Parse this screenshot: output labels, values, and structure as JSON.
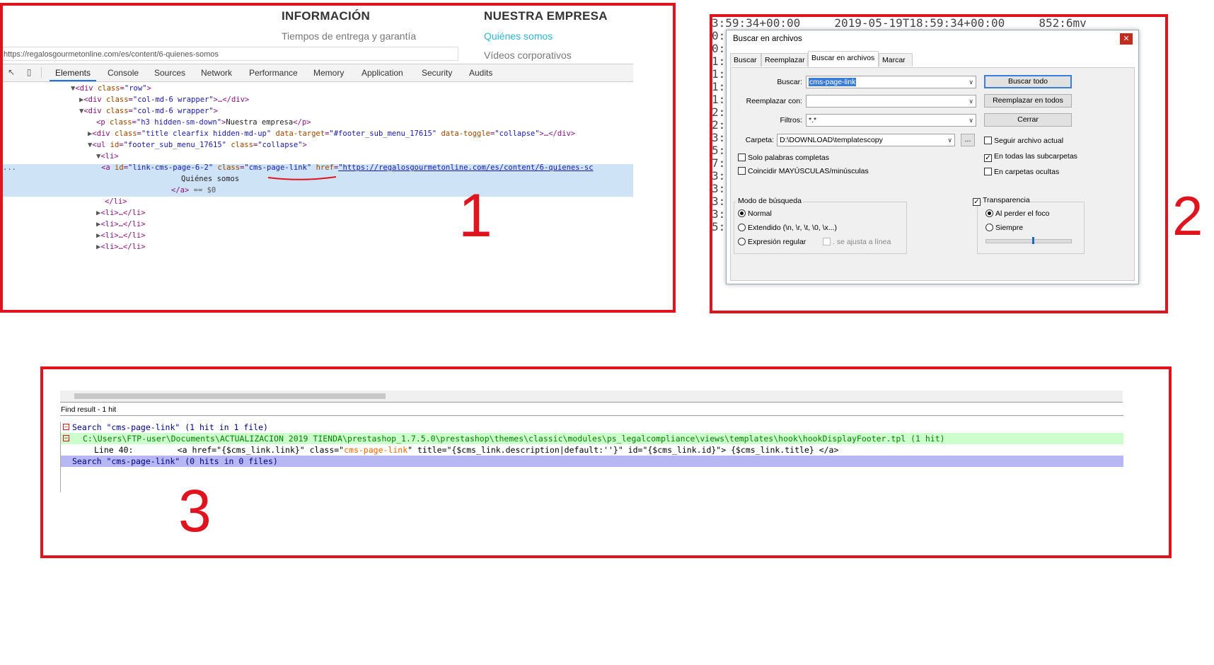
{
  "labels": [
    "1",
    "2",
    "3"
  ],
  "panel1": {
    "site": {
      "heading1": "INFORMACIÓN",
      "link1": "Tiempos de entrega y garantía",
      "heading2": "NUESTRA EMPRESA",
      "link2": "Quiénes somos",
      "link3": "Vídeos corporativos",
      "url": "https://regalosgourmetonline.com/es/content/6-quienes-somos"
    },
    "tabs": [
      "Elements",
      "Console",
      "Sources",
      "Network",
      "Performance",
      "Memory",
      "Application",
      "Security",
      "Audits"
    ],
    "active_tab": "Elements",
    "dom": {
      "l1_tag": "<div ",
      "l1_an": "class",
      "l1_av": "\"row\"",
      "l1_end": ">",
      "l2_pre": "▶",
      "l2_tag": "<div ",
      "l2_an": "class",
      "l2_av": "\"col-md-6 wrapper\"",
      "l2_end": ">…</div>",
      "l3_pre": "▼",
      "l3_tag": "<div ",
      "l3_an": "class",
      "l3_av": "\"col-md-6 wrapper\"",
      "l3_end": ">",
      "l4_tag": "<p ",
      "l4_an": "class",
      "l4_av": "\"h3 hidden-sm-down\"",
      "l4_tx": "Nuestra empresa",
      "l4_end": "</p>",
      "l5_pre": "▶",
      "l5_tag": "<div ",
      "l5_an": "class",
      "l5_av": "\"title clearfix hidden-md-up\"",
      "l5_an2": "data-target",
      "l5_av2": "\"#footer_sub_menu_17615\"",
      "l5_an3": "data-toggle",
      "l5_av3": "\"collapse\"",
      "l5_end": ">…</div>",
      "l6_pre": "▼",
      "l6_tag": "<ul ",
      "l6_an": "id",
      "l6_av": "\"footer_sub_menu_17615\"",
      "l6_an2": "class",
      "l6_av2": "\"collapse\"",
      "l6_end": ">",
      "l7_pre": "▼",
      "l7_tag": "<li>",
      "l8_dots": "...",
      "l8_tag": "<a ",
      "l8_an": "id",
      "l8_av": "\"link-cms-page-6-2\"",
      "l8_an2": "class",
      "l8_av2": "\"cms-page-link\"",
      "l8_an3": "href",
      "l8_av3": "\"https://regalosgourmetonline.com/es/content/6-quienes-sc",
      "l9_tx": "Quiénes somos",
      "l10_tag": "</a>",
      "l10_tx": " == $0",
      "l11_tag": "</li>",
      "collapsed_li": "<li>…</li>"
    }
  },
  "panel2": {
    "background_text": "3:59:34+00:00     2019-05-19T18:59:34+00:00     852:6mv\n0:                                                     4\n0:                                                     l\n1:                                                     7\n1:                                                     f\n1:                                                     f\n1:                                                     x\n2:                                                     3\n2:                                                     f\n3:                                                     f\n5:                                                     x\n7:                                                     x\n3:                                                     4\n3:                                                     5\n3:                                                     y\n3:                                                     7\n5:07:58+00:00      2019-05-20T09:07:58+00:00     232.1",
    "title": "Buscar en archivos",
    "close": "✕",
    "tabs": [
      "Buscar",
      "Reemplazar",
      "Buscar en archivos",
      "Marcar"
    ],
    "active_tab": "Buscar en archivos",
    "fields": {
      "buscar_label": "Buscar:",
      "buscar_value": "cms-page-link",
      "reemplazar_label": "Reemplazar con:",
      "reemplazar_value": "",
      "filtros_label": "Filtros:",
      "filtros_value": "*.*",
      "carpeta_label": "Carpeta:",
      "carpeta_value": "D:\\DOWNLOAD\\templatescopy",
      "browse": "..."
    },
    "buttons": {
      "buscar_todo": "Buscar todo",
      "reemplazar_todos": "Reemplazar en todos",
      "cerrar": "Cerrar"
    },
    "checks": {
      "seguir": "Seguir archivo actual",
      "subcarpetas": "En todas las subcarpetas",
      "ocultas": "En carpetas ocultas",
      "palabras": "Solo palabras completas",
      "mayus": "Coincidir MAYÚSCULAS/minúsculas",
      "checkmark": "✓"
    },
    "modo": {
      "title": "Modo de búsqueda",
      "normal": "Normal",
      "extendido": "Extendido (\\n, \\r, \\t, \\0, \\x...)",
      "regex": "Expresión regular",
      "newline": ". se ajusta a línea"
    },
    "transparencia": {
      "title": "Transparencia",
      "foco": "Al perder el foco",
      "siempre": "Siempre",
      "level": 0.55
    }
  },
  "panel3": {
    "header": "Find result - 1 hit",
    "fold": "−",
    "line1": "Search \"cms-page-link\" (1 hit in 1 file)",
    "line2": "C:\\Users\\FTP-user\\Documents\\ACTUALIZACION 2019 TIENDA\\prestashop_1.7.5.0\\prestashop\\themes\\classic\\modules\\ps_legalcompliance\\views\\templates\\hook\\hookDisplayFooter.tpl (1 hit)",
    "line3_a": "Line 40:         <a href=\"{$cms_link.link}\" class=\"",
    "line3_b": "cms-page-link",
    "line3_c": "\" title=\"{$cms_link.description|default:''}\" id=\"{$cms_link.id}\"> {$cms_link.title} </a>",
    "line4": "Search \"cms-page-link\" (0 hits in 0 files)"
  }
}
